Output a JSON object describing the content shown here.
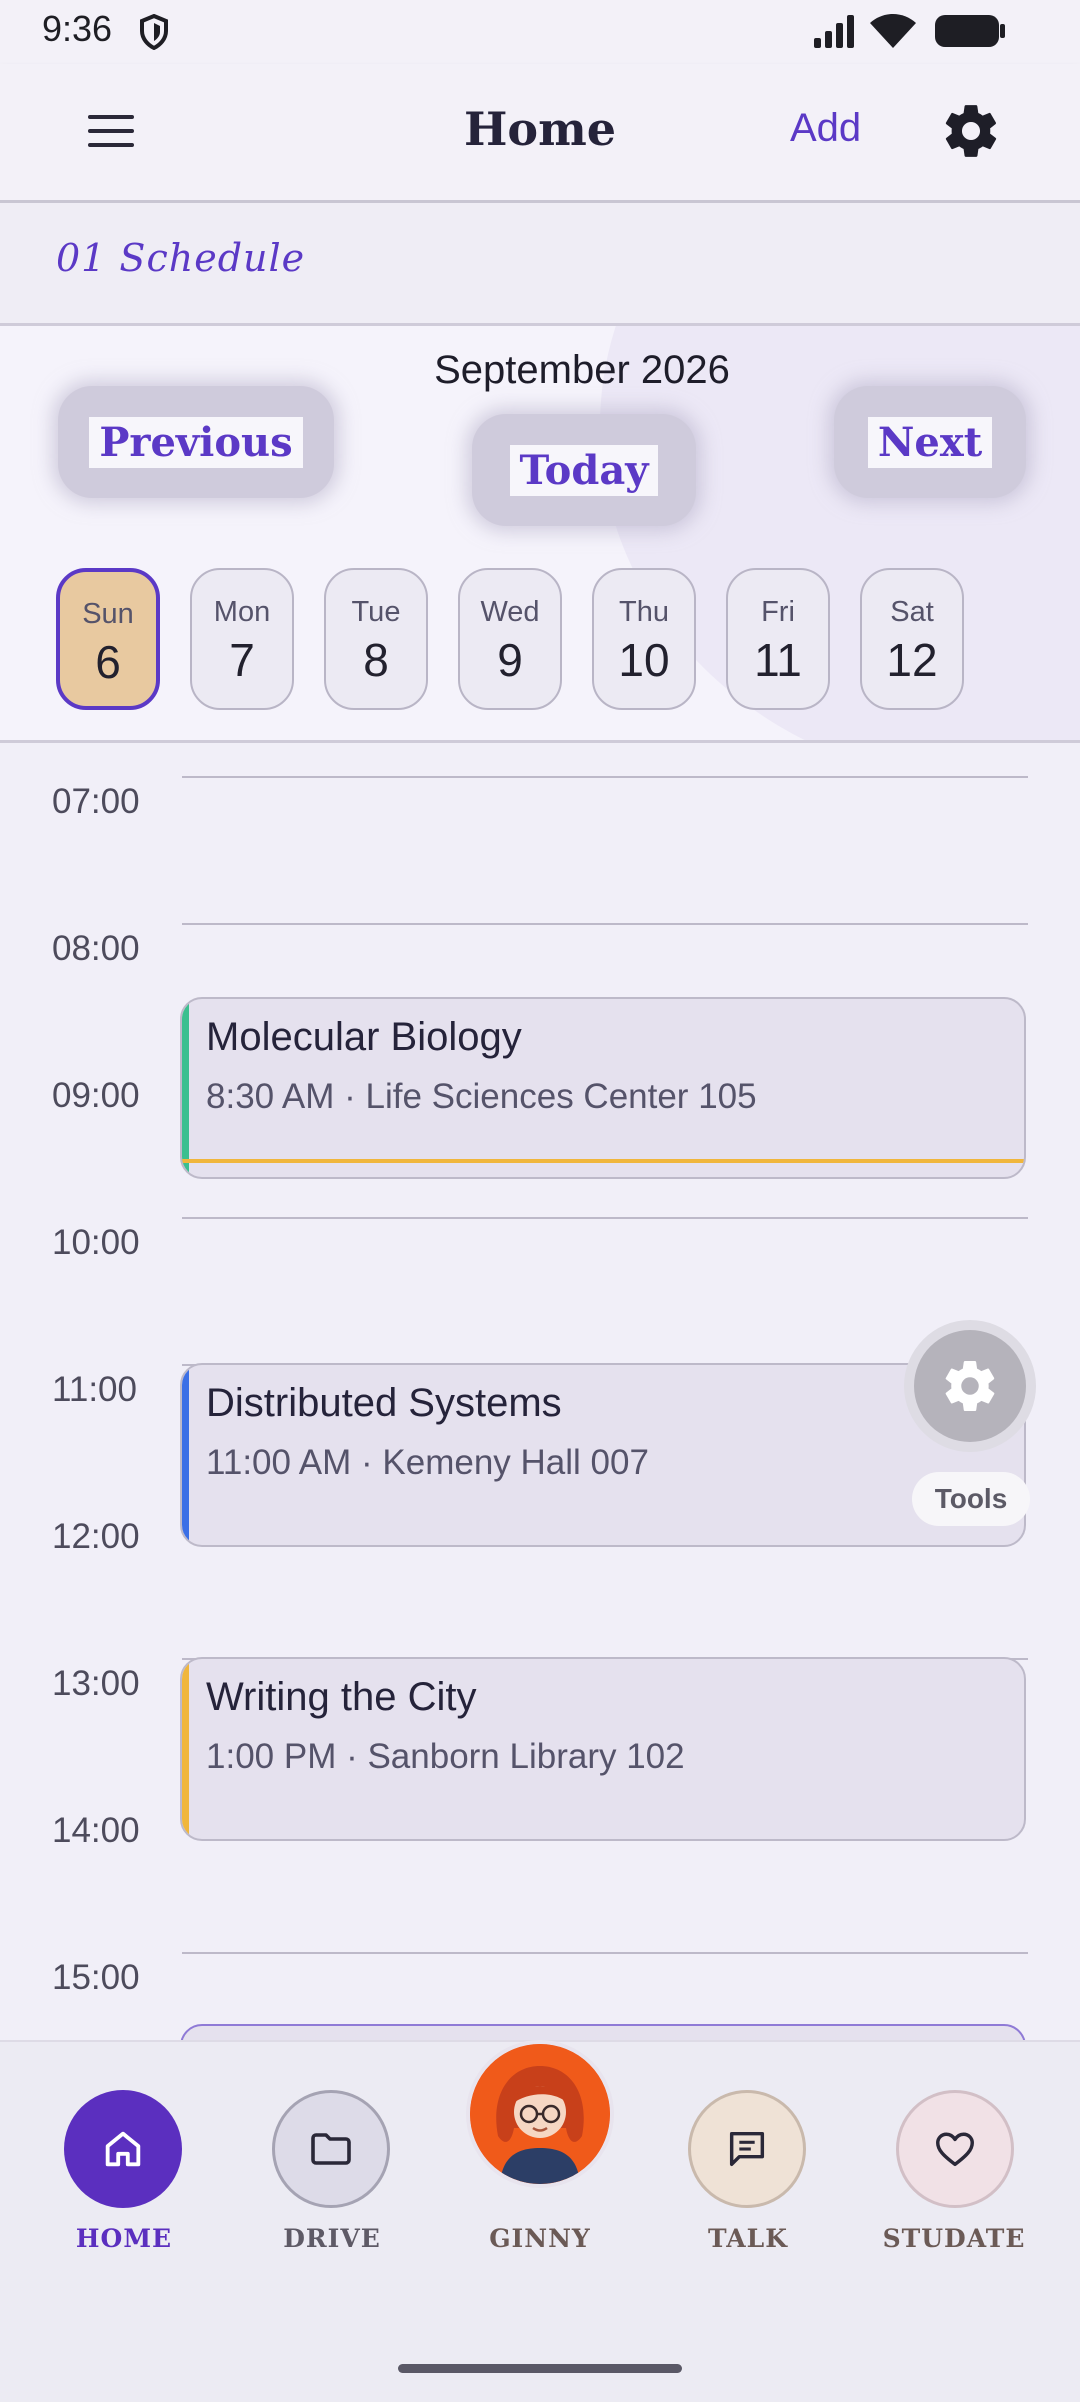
{
  "status_bar": {
    "time": "9:36"
  },
  "app_bar": {
    "title": "Home",
    "add_label": "Add"
  },
  "section": {
    "label": "01 Schedule"
  },
  "calendar": {
    "month": "September 2026",
    "prev_label": "Previous",
    "today_label": "Today",
    "next_label": "Next",
    "days": [
      {
        "name": "Sun",
        "date": "6",
        "selected": true
      },
      {
        "name": "Mon",
        "date": "7"
      },
      {
        "name": "Tue",
        "date": "8"
      },
      {
        "name": "Wed",
        "date": "9"
      },
      {
        "name": "Thu",
        "date": "10"
      },
      {
        "name": "Fri",
        "date": "11"
      },
      {
        "name": "Sat",
        "date": "12"
      }
    ]
  },
  "timeline": {
    "hours": [
      "07:00",
      "08:00",
      "09:00",
      "10:00",
      "11:00",
      "12:00",
      "13:00",
      "14:00",
      "15:00"
    ],
    "events": [
      {
        "title": "Molecular Biology",
        "subtitle": "8:30 AM · Life Sciences Center 105",
        "accent": "#3bbf8f",
        "underline": "#f0b63c"
      },
      {
        "title": "Distributed Systems",
        "subtitle": "11:00 AM · Kemeny Hall 007",
        "accent": "#3b6fe6"
      },
      {
        "title": "Writing the City",
        "subtitle": "1:00 PM · Sanborn Library 102",
        "accent": "#f0b63c"
      }
    ]
  },
  "tools": {
    "label": "Tools"
  },
  "bottom_nav": {
    "items": [
      {
        "label": "HOME",
        "icon": "home-icon",
        "active": true
      },
      {
        "label": "DRIVE",
        "icon": "folder-icon"
      },
      {
        "label": "GINNY",
        "icon": "ginny-avatar"
      },
      {
        "label": "TALK",
        "icon": "chat-icon"
      },
      {
        "label": "STUDATE",
        "icon": "heart-icon"
      }
    ]
  },
  "colors": {
    "accent": "#5b39c6",
    "selected_day": "#e8c9a0"
  }
}
